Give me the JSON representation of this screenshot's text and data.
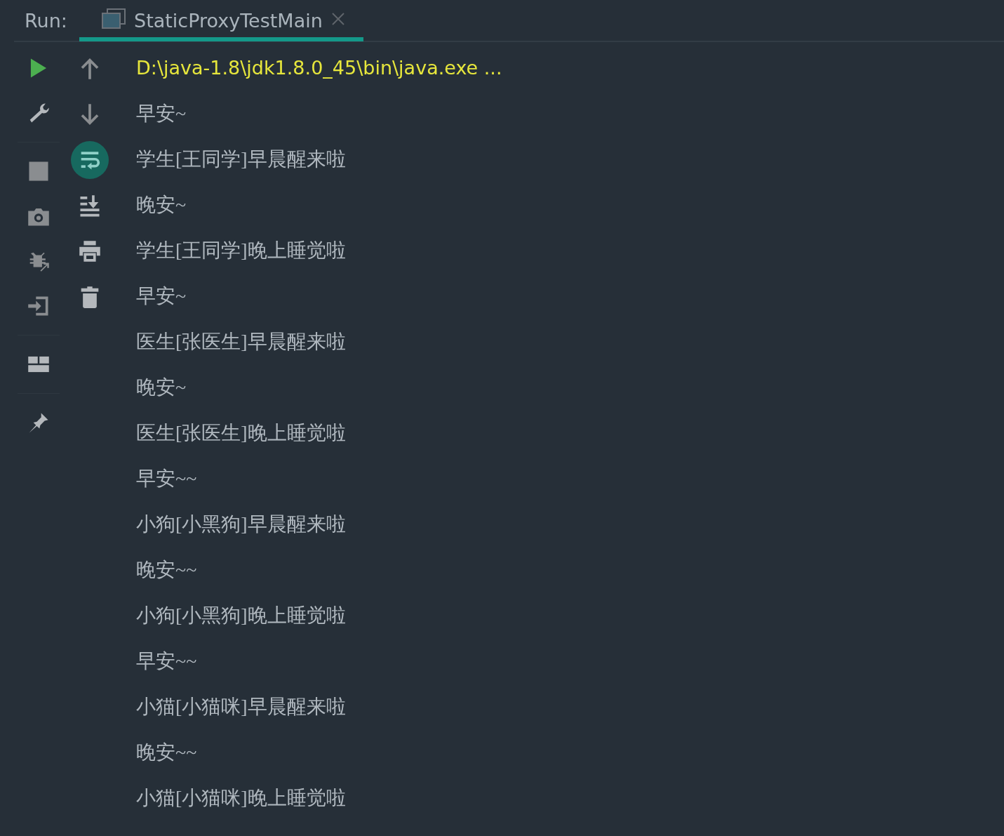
{
  "run_label": "Run:",
  "tabs": [
    {
      "title": "StaticProxyTestMain",
      "selected": true
    }
  ],
  "toolbar_left": {
    "groups": [
      {
        "items": [
          {
            "kind": "run"
          },
          {
            "kind": "wrench"
          }
        ]
      },
      {
        "items": [
          {
            "kind": "stop"
          },
          {
            "kind": "camera"
          },
          {
            "kind": "bug"
          },
          {
            "kind": "import"
          }
        ]
      },
      {
        "items": [
          {
            "kind": "layout"
          }
        ]
      },
      {
        "items": [
          {
            "kind": "pin"
          }
        ]
      }
    ]
  },
  "toolbar_right": [
    {
      "kind": "up",
      "selected": false
    },
    {
      "kind": "down",
      "selected": false
    },
    {
      "kind": "wrap",
      "selected": true
    },
    {
      "kind": "scroll-end",
      "selected": false
    },
    {
      "kind": "print",
      "selected": false
    },
    {
      "kind": "trash",
      "selected": false
    }
  ],
  "console": {
    "lines": [
      {
        "kind": "command",
        "text": "D:\\java-1.8\\jdk1.8.0_45\\bin\\java.exe ..."
      },
      {
        "kind": "output",
        "text": "早安~"
      },
      {
        "kind": "output",
        "text": "学生[王同学]早晨醒来啦"
      },
      {
        "kind": "output",
        "text": "晚安~"
      },
      {
        "kind": "output",
        "text": "学生[王同学]晚上睡觉啦"
      },
      {
        "kind": "output",
        "text": "早安~"
      },
      {
        "kind": "output",
        "text": "医生[张医生]早晨醒来啦"
      },
      {
        "kind": "output",
        "text": "晚安~"
      },
      {
        "kind": "output",
        "text": "医生[张医生]晚上睡觉啦"
      },
      {
        "kind": "output",
        "text": "早安~~"
      },
      {
        "kind": "output",
        "text": "小狗[小黑狗]早晨醒来啦"
      },
      {
        "kind": "output",
        "text": "晚安~~"
      },
      {
        "kind": "output",
        "text": "小狗[小黑狗]晚上睡觉啦"
      },
      {
        "kind": "output",
        "text": "早安~~"
      },
      {
        "kind": "output",
        "text": "小猫[小猫咪]早晨醒来啦"
      },
      {
        "kind": "output",
        "text": "晚安~~"
      },
      {
        "kind": "output",
        "text": "小猫[小猫咪]晚上睡觉啦"
      }
    ]
  }
}
